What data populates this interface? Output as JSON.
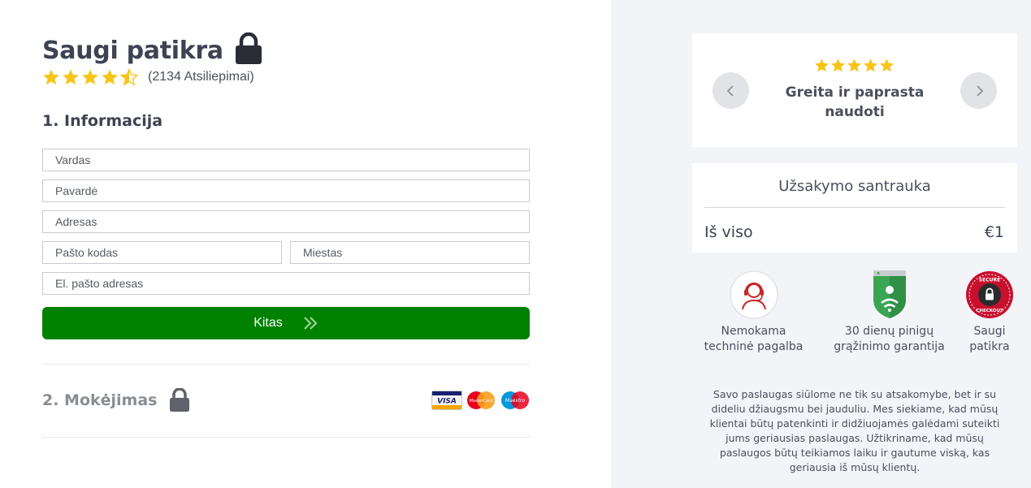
{
  "header": {
    "title": "Saugi patikra",
    "lock_icon": "lock-icon"
  },
  "rating": {
    "stars": 4.5,
    "max": 5,
    "text": "(2134 Atsiliepimai)",
    "star_color": "#f5c518"
  },
  "info_section": {
    "title": "1. Informacija",
    "fields": {
      "first_name": {
        "placeholder": "Vardas",
        "value": ""
      },
      "last_name": {
        "placeholder": "Pavardė",
        "value": ""
      },
      "address": {
        "placeholder": "Adresas",
        "value": ""
      },
      "postal_code": {
        "placeholder": "Pašto kodas",
        "value": ""
      },
      "city": {
        "placeholder": "Miestas",
        "value": ""
      },
      "email": {
        "placeholder": "El. pašto adresas",
        "value": ""
      }
    },
    "next_button": {
      "label": "Kitas",
      "color": "#008200",
      "icon": "double-chevron-right-icon"
    }
  },
  "payment_section": {
    "title": "2. Mokėjimas",
    "lock_icon": "lock-icon",
    "cards": [
      "VISA",
      "MasterCard",
      "Maestro"
    ]
  },
  "review_carousel": {
    "stars": 5,
    "text": "Greita ir paprasta naudoti",
    "prev_icon": "chevron-left-icon",
    "next_icon": "chevron-right-icon"
  },
  "order_summary": {
    "title": "Užsakymo santrauka",
    "total_label": "Iš viso",
    "total_value": "€1"
  },
  "badges": [
    {
      "label": "Nemokama techninė pagalba",
      "icon": "support-agent-icon"
    },
    {
      "label": "30 dienų pinigų grąžinimo garantija",
      "icon": "shield-guarantee-icon"
    },
    {
      "label": "Saugi patikra",
      "icon": "secure-checkout-icon",
      "seal_text_top": "SECURE",
      "seal_text_bottom": "CHECKOUT"
    }
  ],
  "about_text": "Savo paslaugas siūlome ne tik su atsakomybe, bet ir su dideliu džiaugsmu bei jauduliu. Mes siekiame, kad mūsų klientai būtų patenkinti ir didžiuojamės galėdami suteikti jums geriausias paslaugas. Užtikriname, kad mūsų paslaugos būtų teikiamos laiku ir gautume viską, kas geriausia iš mūsų klientų."
}
